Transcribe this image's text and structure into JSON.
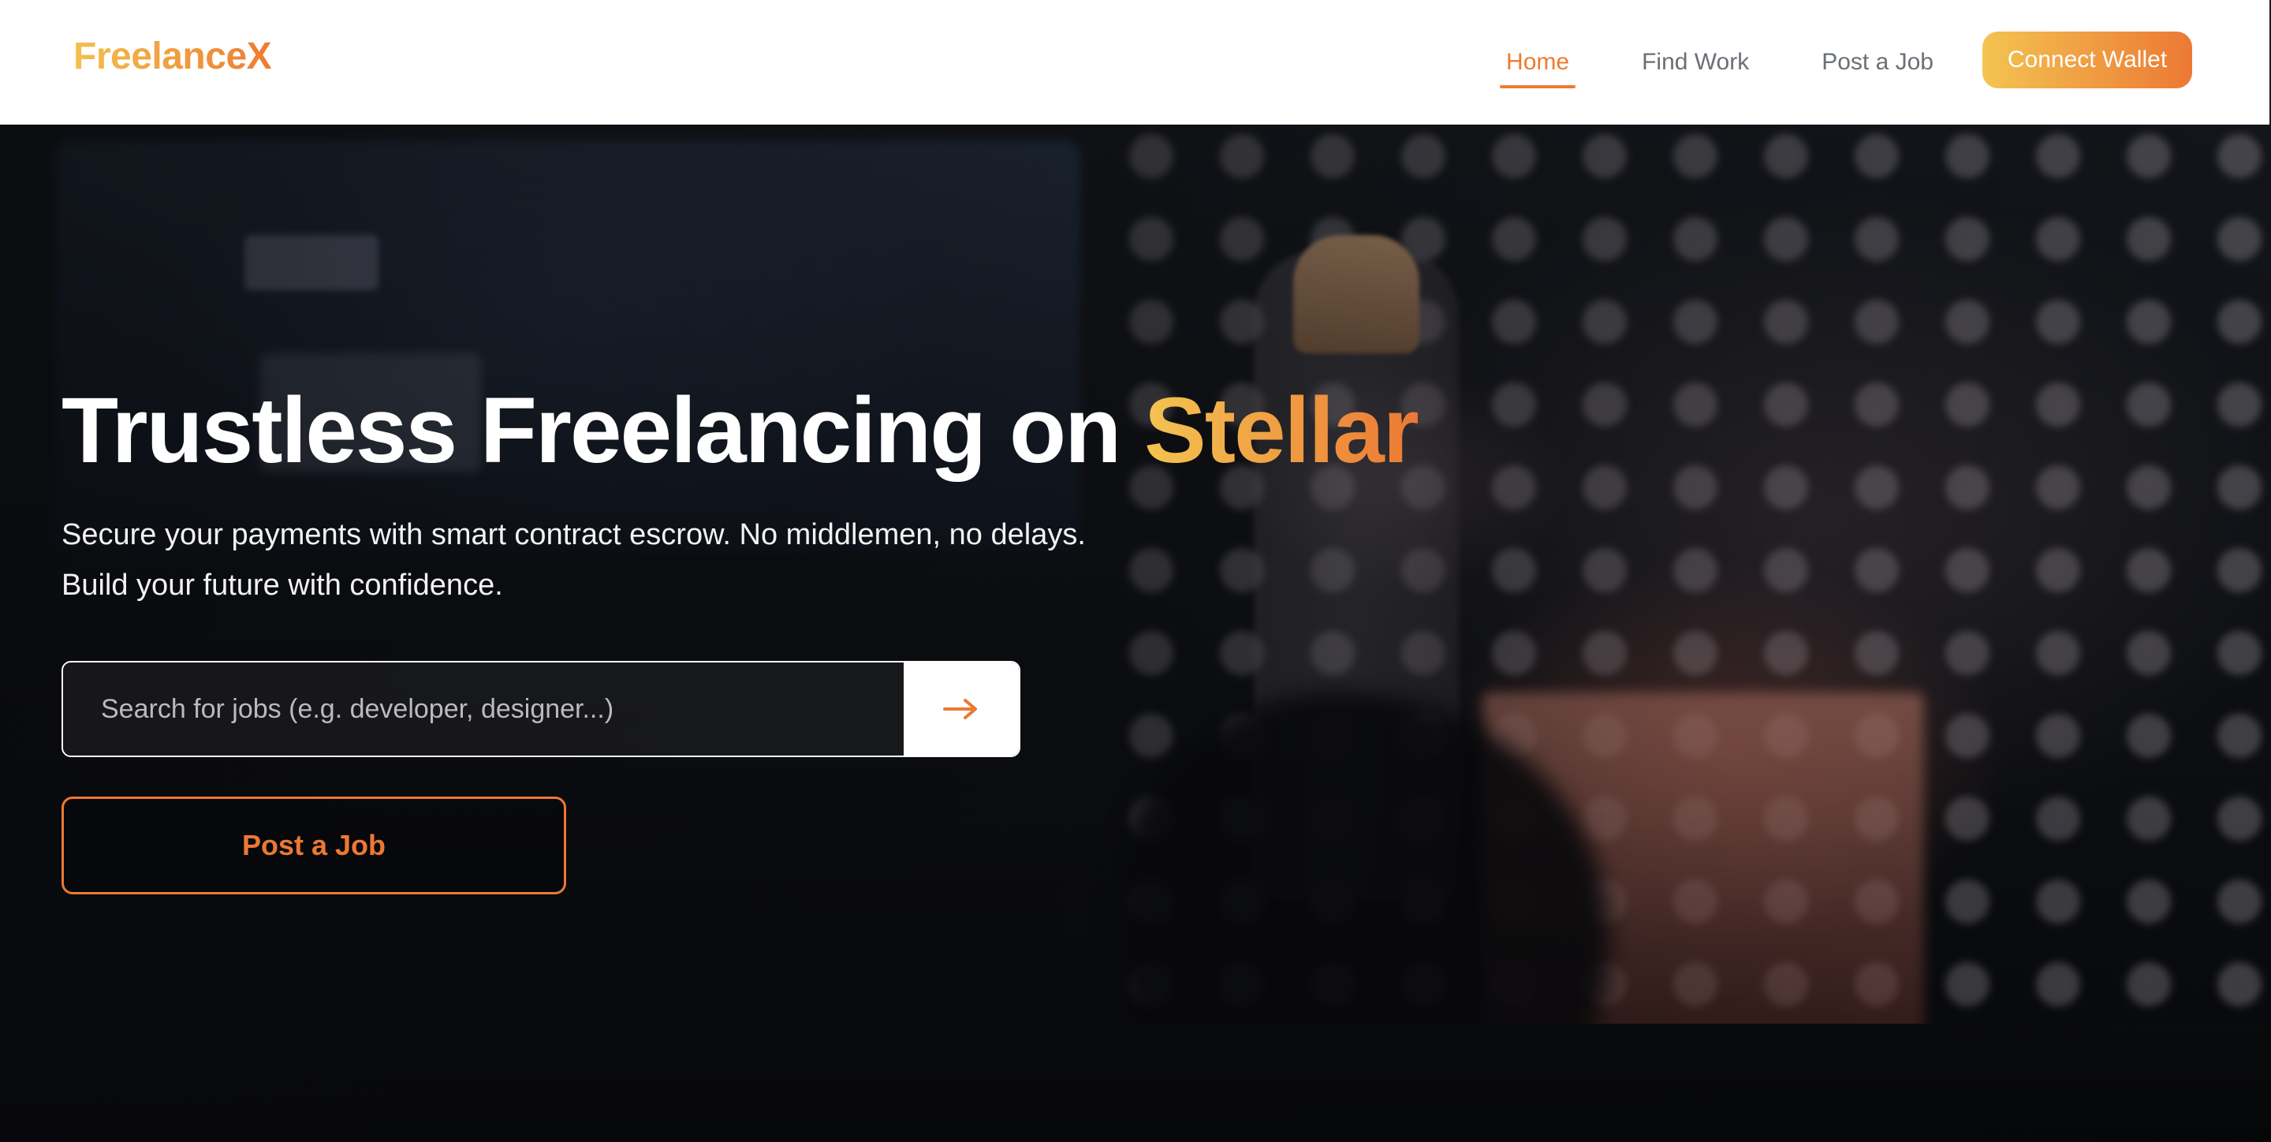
{
  "brand": {
    "name": "FreelanceX"
  },
  "nav": {
    "items": [
      {
        "label": "Home",
        "active": true
      },
      {
        "label": "Find Work",
        "active": false
      },
      {
        "label": "Post a Job",
        "active": false
      }
    ],
    "connect_label": "Connect Wallet"
  },
  "hero": {
    "title_main": "Trustless Freelancing on ",
    "title_accent": "Stellar",
    "subtitle_line1": "Secure your payments with smart contract escrow. No middlemen, no delays.",
    "subtitle_line2": "Build your future with confidence.",
    "search": {
      "placeholder": "Search for jobs (e.g. developer, designer...)",
      "value": "",
      "submit_icon": "arrow-right-icon"
    },
    "post_job_label": "Post a Job"
  },
  "colors": {
    "accent_start": "#f3c451",
    "accent_end": "#ec7834",
    "nav_text": "#6b6f76",
    "header_bg": "#ffffff"
  }
}
